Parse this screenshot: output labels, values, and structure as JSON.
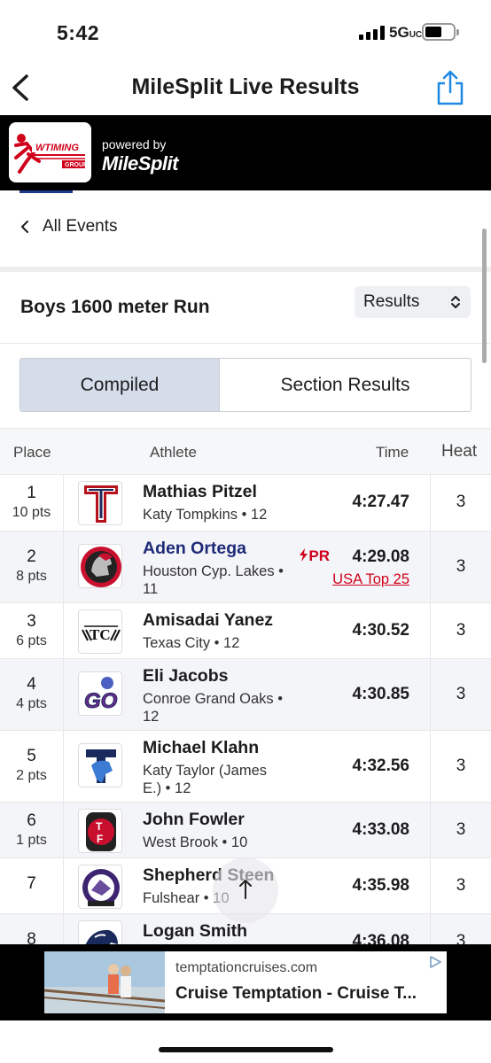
{
  "status": {
    "time": "5:42",
    "network": "5G",
    "network_suffix": "UC"
  },
  "nav": {
    "title": "MileSplit Live Results"
  },
  "banner": {
    "logo_text": "WTIMING",
    "logo_sub": "GROUP",
    "powered_by": "powered by",
    "brand": "MileSplit"
  },
  "events_link": {
    "label": "All Events"
  },
  "event": {
    "title": "Boys 1600 meter Run",
    "view_select": "Results"
  },
  "tabs": [
    {
      "label": "Compiled",
      "active": true
    },
    {
      "label": "Section Results",
      "active": false
    }
  ],
  "table": {
    "headers": {
      "place": "Place",
      "athlete": "Athlete",
      "time": "Time",
      "heat": "Heat"
    },
    "rows": [
      {
        "place": "1",
        "pts": "10 pts",
        "name": "Mathias Pitzel",
        "school": "Katy Tompkins • 12",
        "time": "4:27.47",
        "heat": "3",
        "logo": "tompkins-logo"
      },
      {
        "place": "2",
        "pts": "8 pts",
        "name": "Aden Ortega",
        "school": "Houston Cyp. Lakes • 11",
        "time": "4:29.08",
        "heat": "3",
        "pr": "PR",
        "badge": "USA Top 25",
        "logo": "cypress-lakes-spartan-logo"
      },
      {
        "place": "3",
        "pts": "6 pts",
        "name": "Amisadai Yanez",
        "school": "Texas City • 12",
        "time": "4:30.52",
        "heat": "3",
        "logo": "texas-city-logo"
      },
      {
        "place": "4",
        "pts": "4 pts",
        "name": "Eli Jacobs",
        "school": "Conroe Grand Oaks • 12",
        "time": "4:30.85",
        "heat": "3",
        "logo": "grand-oaks-logo"
      },
      {
        "place": "5",
        "pts": "2 pts",
        "name": "Michael Klahn",
        "school": "Katy Taylor (James E.) • 12",
        "time": "4:32.56",
        "heat": "3",
        "logo": "katy-taylor-mustang-logo"
      },
      {
        "place": "6",
        "pts": "1 pts",
        "name": "John Fowler",
        "school": "West Brook • 10",
        "time": "4:33.08",
        "heat": "3",
        "logo": "west-brook-logo"
      },
      {
        "place": "7",
        "pts": "",
        "name": "Shepherd Steen",
        "school": "Fulshear • 10",
        "time": "4:35.98",
        "heat": "3",
        "logo": "fulshear-logo"
      },
      {
        "place": "8",
        "pts": "",
        "name": "Logan Smith",
        "school": "",
        "time": "4:36.08",
        "heat": "3",
        "logo": "horse-logo"
      }
    ]
  },
  "ad": {
    "domain": "temptationcruises.com",
    "headline": "Cruise Temptation - Cruise T..."
  },
  "colors": {
    "accent_blue": "#1e88e5",
    "link_navy": "#1e2a78",
    "pr_red": "#d0021b",
    "active_tab": "#d5dcea"
  }
}
